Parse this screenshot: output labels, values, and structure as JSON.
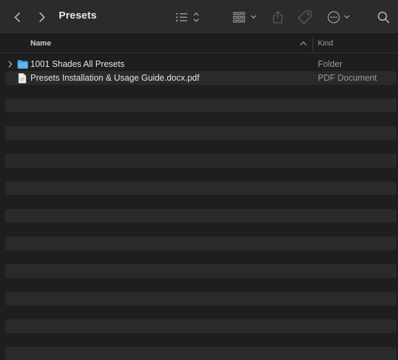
{
  "toolbar": {
    "title": "Presets",
    "icons": {
      "back": "chevron-left-icon",
      "forward": "chevron-right-icon",
      "view": "list-view-icon",
      "group": "grid-group-icon",
      "share": "share-icon",
      "tags": "tag-icon",
      "more": "ellipsis-circle-icon",
      "search": "search-icon"
    }
  },
  "columns": {
    "name": "Name",
    "kind": "Kind"
  },
  "files": [
    {
      "name": "1001 Shades All Presets",
      "kind": "Folder",
      "type": "folder",
      "expandable": true
    },
    {
      "name": "Presets Installation & Usage Guide.docx.pdf",
      "kind": "PDF Document",
      "type": "document",
      "expandable": false
    }
  ],
  "colors": {
    "background": "#1e1e1e",
    "toolbar": "#2b2b2b",
    "stripe": "#2a2a2a",
    "folder": "#4aa8e8"
  }
}
